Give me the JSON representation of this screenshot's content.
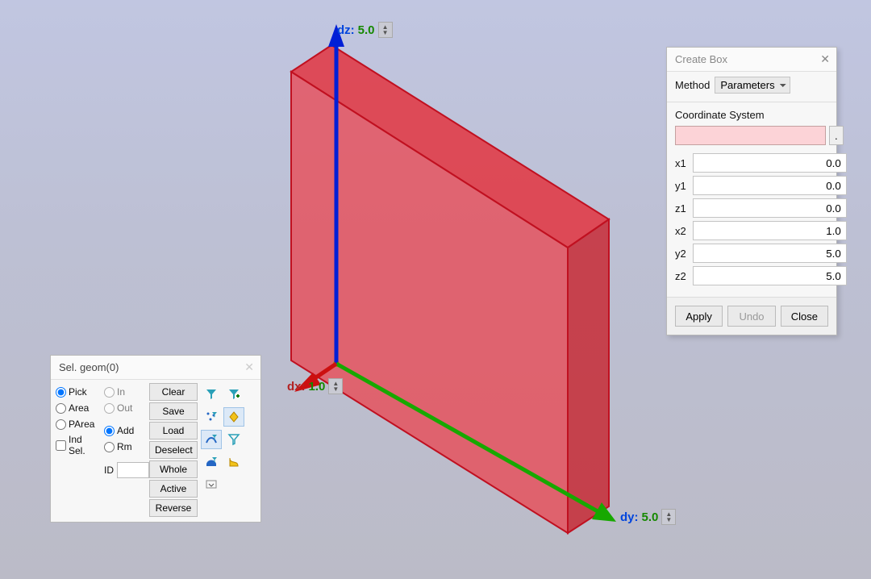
{
  "viewport": {
    "axes": {
      "dx": {
        "name": "dx",
        "value": "1.0"
      },
      "dy": {
        "name": "dy",
        "value": "5.0"
      },
      "dz": {
        "name": "dz",
        "value": "5.0"
      }
    }
  },
  "create_box": {
    "title": "Create Box",
    "method_label": "Method",
    "method_value": "Parameters",
    "coord_sys_label": "Coordinate System",
    "coord_sys_value": "",
    "fields": {
      "x1": {
        "label": "x1",
        "value": "0.0"
      },
      "y1": {
        "label": "y1",
        "value": "0.0"
      },
      "z1": {
        "label": "z1",
        "value": "0.0"
      },
      "x2": {
        "label": "x2",
        "value": "1.0"
      },
      "y2": {
        "label": "y2",
        "value": "5.0"
      },
      "z2": {
        "label": "z2",
        "value": "5.0"
      }
    },
    "buttons": {
      "apply": "Apply",
      "undo": "Undo",
      "close": "Close"
    }
  },
  "sel_panel": {
    "title": "Sel. geom(0)",
    "col1": {
      "pick": "Pick",
      "area": "Area",
      "parea": "PArea"
    },
    "col2": {
      "in": "In",
      "out": "Out",
      "add": "Add",
      "rm": "Rm"
    },
    "btns": {
      "clear": "Clear",
      "save": "Save",
      "load": "Load",
      "deselect": "Deselect",
      "whole": "Whole",
      "active": "Active",
      "reverse": "Reverse"
    },
    "ind_sel": {
      "chk": "Ind Sel.",
      "id_label": "ID"
    }
  }
}
